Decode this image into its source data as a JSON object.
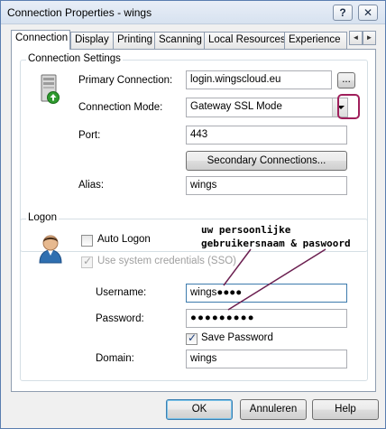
{
  "window": {
    "title": "Connection Properties - wings",
    "help_glyph": "?",
    "close_glyph": "✕"
  },
  "tabs": [
    "Connection",
    "Display",
    "Printing",
    "Scanning",
    "Local Resources",
    "Experience"
  ],
  "tab_scroll": {
    "left": "◄",
    "right": "►"
  },
  "connection_settings": {
    "legend": "Connection Settings",
    "primary_connection_label": "Primary Connection:",
    "primary_connection_value": "login.wingscloud.eu",
    "browse_label": "...",
    "connection_mode_label": "Connection Mode:",
    "connection_mode_value": "Gateway SSL Mode",
    "port_label": "Port:",
    "port_value": "443",
    "secondary_button": "Secondary Connections...",
    "alias_label": "Alias:",
    "alias_value": "wings"
  },
  "logon": {
    "legend": "Logon",
    "auto_logon_label": "Auto Logon",
    "auto_logon_checked": false,
    "sso_label": "Use system credentials (SSO)",
    "sso_checked": true,
    "username_label": "Username:",
    "username_value": "wings●●●●",
    "password_label": "Password:",
    "password_value": "●●●●●●●●●",
    "save_password_label": "Save Password",
    "save_password_checked": true,
    "domain_label": "Domain:",
    "domain_value": "wings"
  },
  "annotation": {
    "line1": "uw persoonlijke",
    "line2": "gebruikersnaam & paswoord",
    "color": "#6b1f50"
  },
  "footer": {
    "ok": "OK",
    "cancel": "Annuleren",
    "help": "Help"
  },
  "colors": {
    "highlight": "#a0205c",
    "accent": "#3c7fb1"
  }
}
